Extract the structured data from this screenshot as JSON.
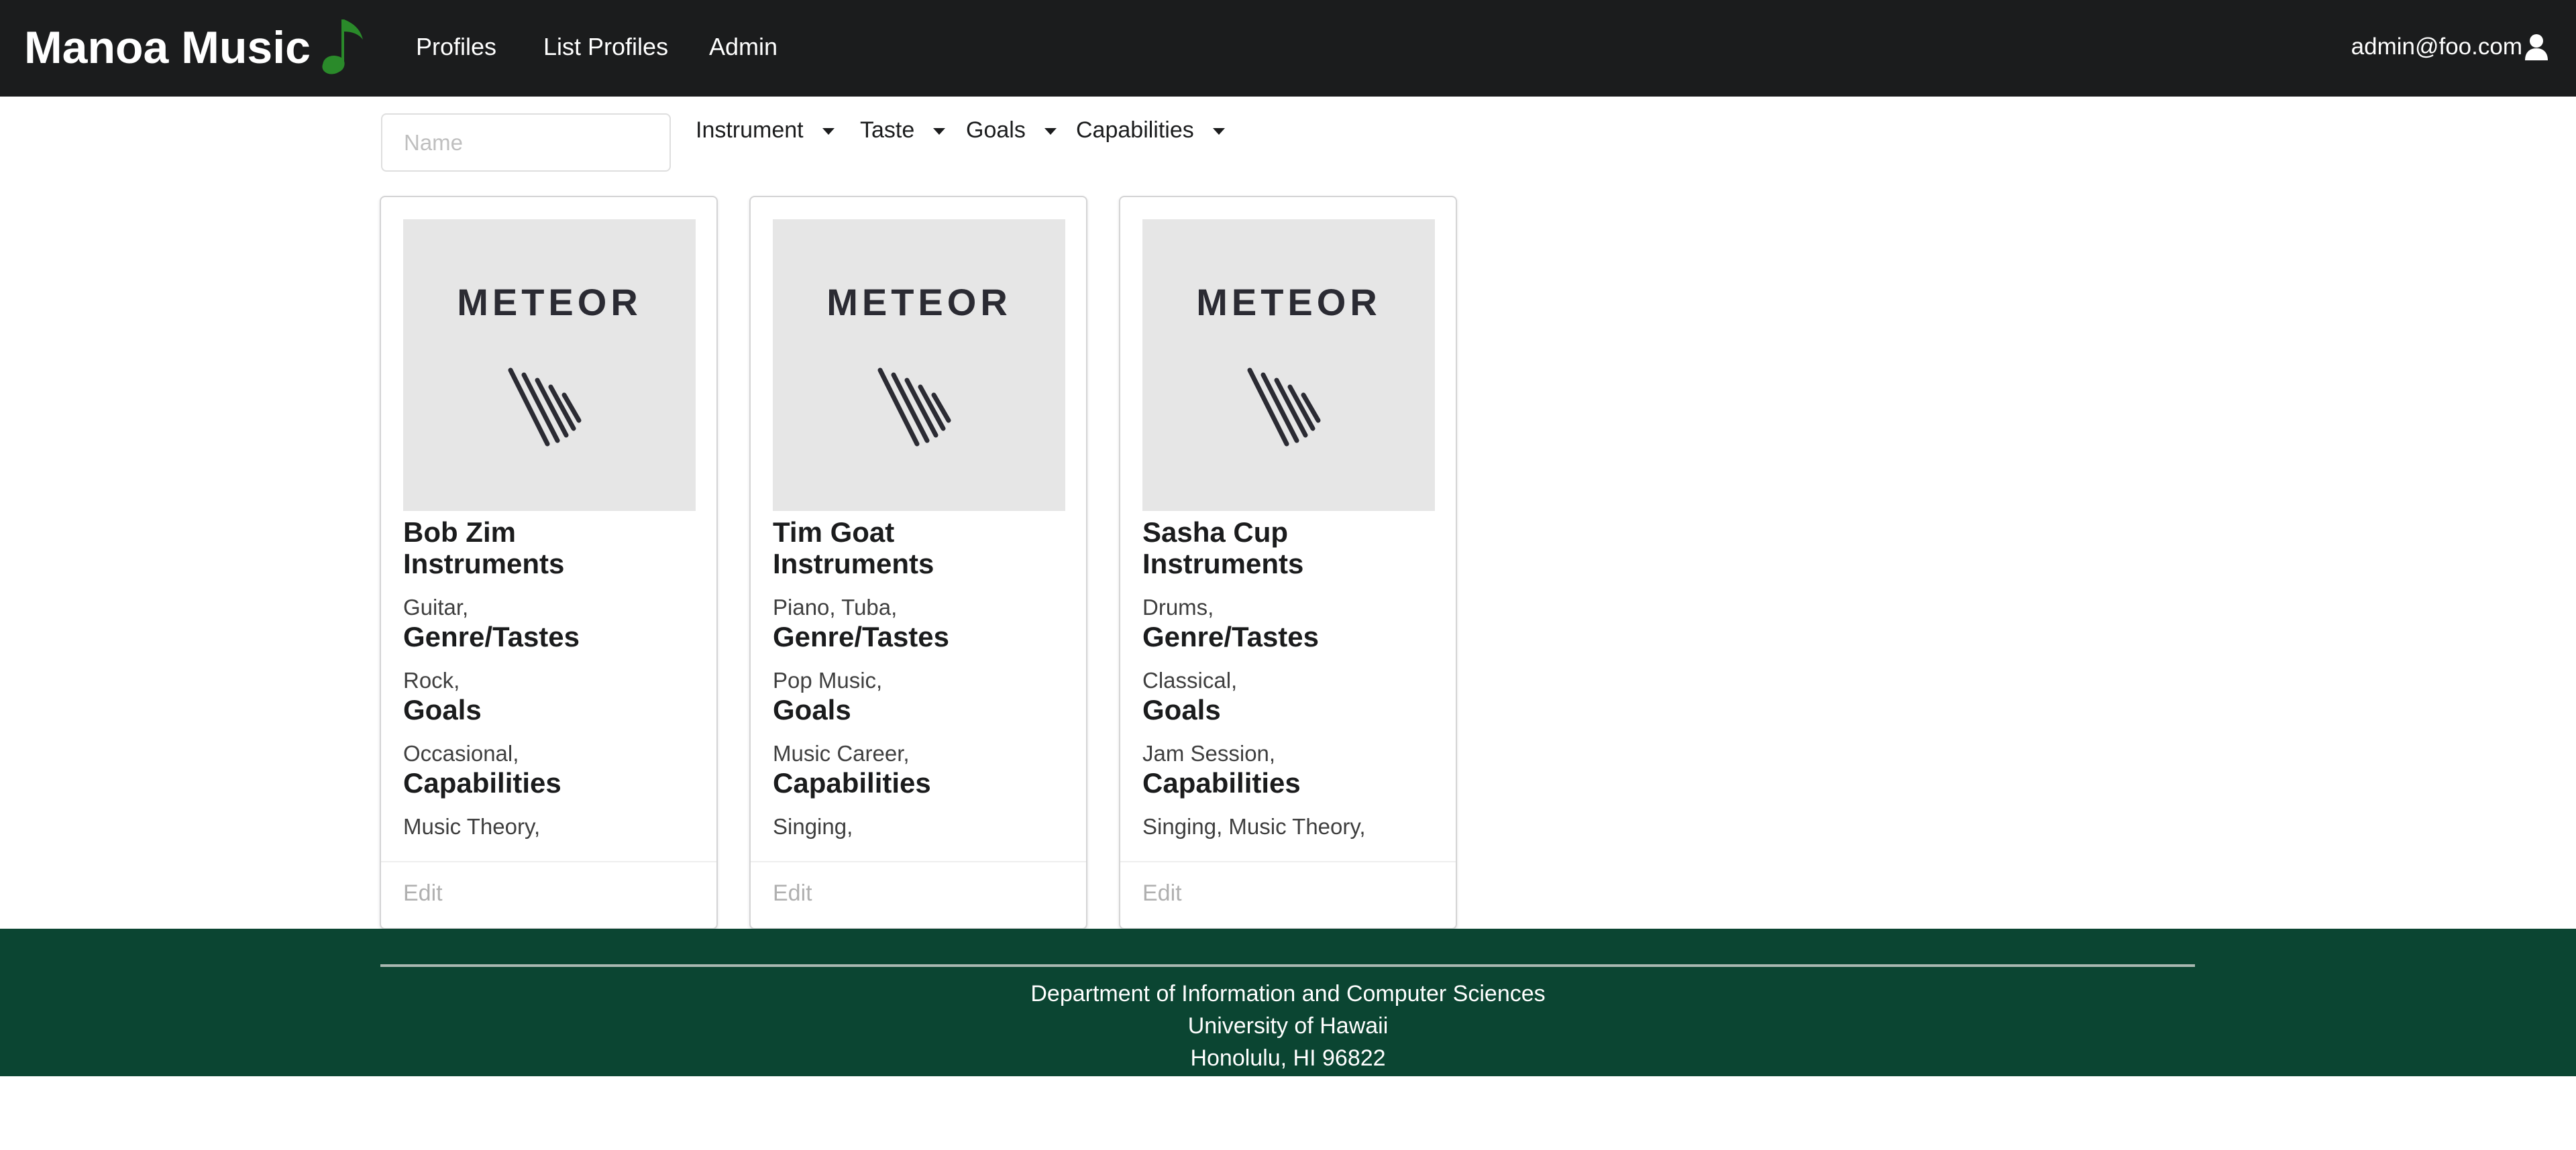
{
  "navbar": {
    "brand": "Manoa Music",
    "brand_icon": "music-note-icon",
    "items": [
      {
        "label": "Profiles"
      },
      {
        "label": "List Profiles"
      },
      {
        "label": "Admin"
      }
    ],
    "user": "admin@foo.com",
    "user_icon": "user-icon"
  },
  "filters": {
    "name_placeholder": "Name",
    "name_value": "",
    "dropdowns": [
      {
        "label": "Instrument"
      },
      {
        "label": "Taste"
      },
      {
        "label": "Goals"
      },
      {
        "label": "Capabilities"
      }
    ]
  },
  "labels": {
    "instruments": "Instruments",
    "genres": "Genre/Tastes",
    "goals": "Goals",
    "capabilities": "Capabilities",
    "edit": "Edit"
  },
  "cards": [
    {
      "image_text": "METEOR",
      "name": "Bob Zim",
      "instruments": "Guitar,",
      "genres": "Rock,",
      "goals": "Occasional,",
      "capabilities": "Music Theory,"
    },
    {
      "image_text": "METEOR",
      "name": "Tim Goat",
      "instruments": "Piano, Tuba,",
      "genres": "Pop Music,",
      "goals": "Music Career,",
      "capabilities": "Singing,"
    },
    {
      "image_text": "METEOR",
      "name": "Sasha Cup",
      "instruments": "Drums,",
      "genres": "Classical,",
      "goals": "Jam Session,",
      "capabilities": "Singing, Music Theory,"
    }
  ],
  "footer": {
    "line1": "Department of Information and Computer Sciences",
    "line2": "University of Hawaii",
    "line3": "Honolulu, HI 96822"
  },
  "colors": {
    "navbar_bg": "#1b1c1d",
    "footer_bg": "#0b4532",
    "note_green": "#2a8a2a",
    "meteor_red": "#d1343a"
  }
}
